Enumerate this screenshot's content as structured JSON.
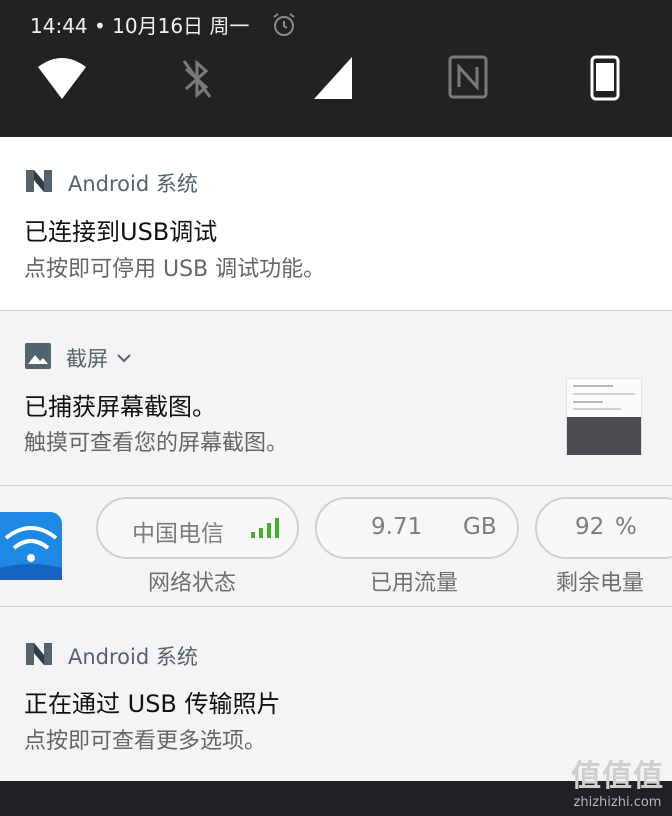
{
  "status_bar": {
    "time_date": "14:44 • 10月16日 周一",
    "icons": [
      "alarm-icon",
      "wifi-icon",
      "bluetooth-icon",
      "cellular-signal-icon",
      "nfc-icon",
      "phone-icon"
    ]
  },
  "notifications": [
    {
      "app": "Android 系统",
      "icon": "android-n-icon",
      "title": "已连接到USB调试",
      "text": "点按即可停用 USB 调试功能。"
    },
    {
      "app": "截屏",
      "icon": "image-icon",
      "expand_icon": "chevron-down-icon",
      "title": "已捕获屏幕截图。",
      "text": "触摸可查看您的屏幕截图。"
    },
    {
      "app": "Android 系统",
      "icon": "android-n-icon",
      "title": "正在通过 USB 传输照片",
      "text": "点按即可查看更多选项。"
    }
  ],
  "widget": {
    "network_value": "中国电信",
    "network_label": "网络状态",
    "data_value": "9.71",
    "data_unit": "GB",
    "data_label": "已用流量",
    "battery_value": "92",
    "battery_unit": "%",
    "battery_label": "剩余电量",
    "signal_bars": 4
  },
  "watermark": {
    "logo_text": "值值值",
    "site": "zhizhizhi.com"
  },
  "colors": {
    "status_bar_bg": "#222222",
    "app_name": "#53646f",
    "signal_green": "#43b02a",
    "widget_app_blue": "#1e88e5"
  }
}
